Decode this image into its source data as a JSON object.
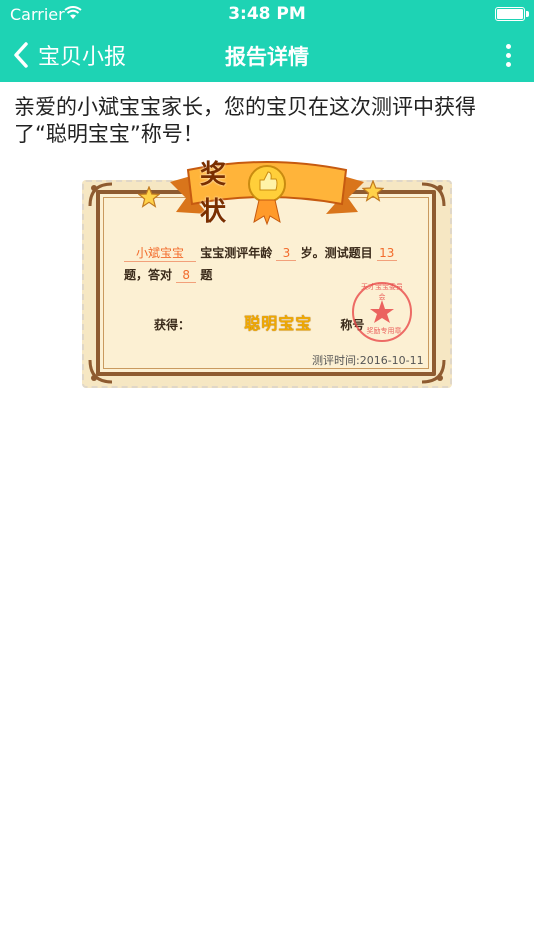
{
  "status_bar": {
    "carrier": "Carrier",
    "time": "3:48 PM"
  },
  "nav": {
    "back_label": "宝贝小报",
    "title": "报告详情"
  },
  "message": "亲爱的小斌宝宝家长，您的宝贝在这次测评中获得了“聪明宝宝”称号！",
  "certificate": {
    "title": "奖状",
    "child_name": "小斌宝宝",
    "age_label": "宝宝测评年龄",
    "age": "3",
    "age_unit": "岁。测试题目",
    "question_count": "13",
    "question_unit": "题，答对",
    "correct_count": "8",
    "correct_unit": "题",
    "award_label": "获得：",
    "award_title": "聪明宝宝",
    "title_suffix": "称号",
    "date": "测评时间:2016-10-11",
    "seal_text": "天才宝宝委员会",
    "seal_caption": "奖励专用章"
  },
  "colors": {
    "accent": "#1ed3b4",
    "fill_text": "#f26c2d",
    "seal": "#e84a4a"
  }
}
